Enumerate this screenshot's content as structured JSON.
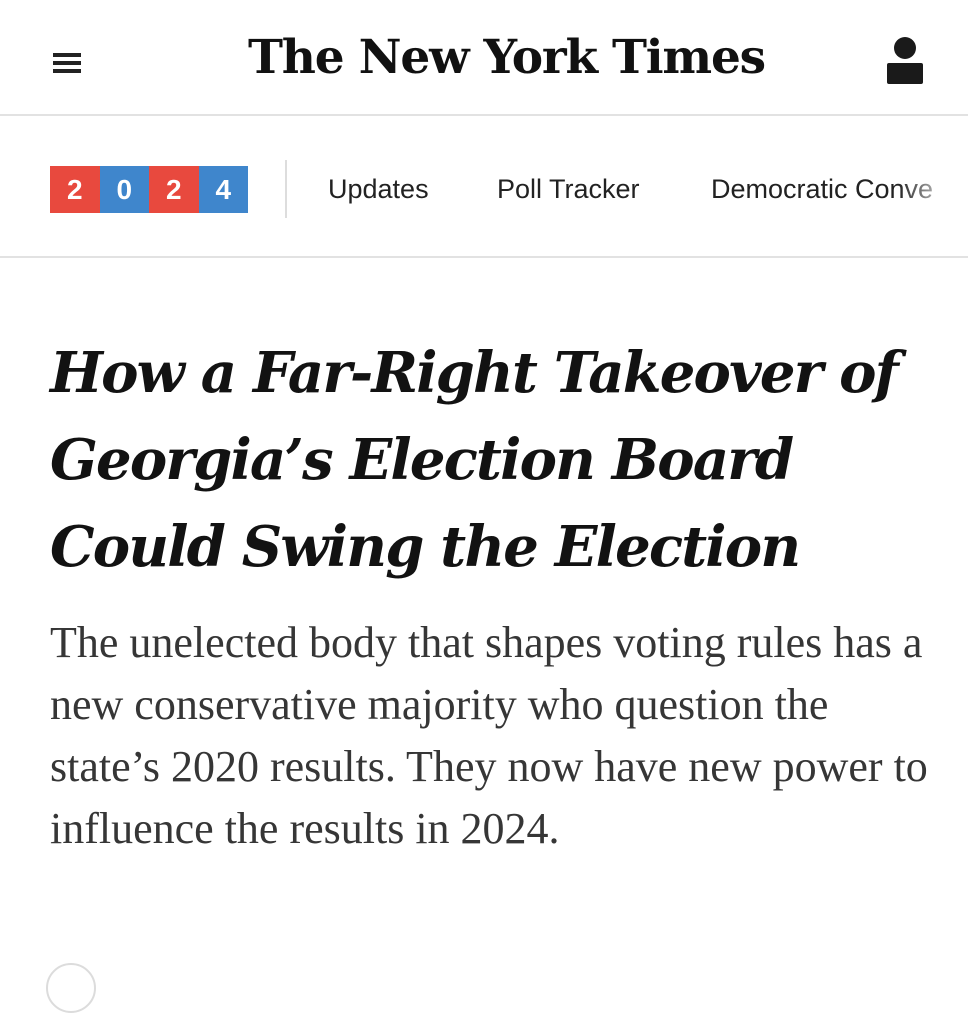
{
  "header": {
    "menu_icon": "hamburger-menu-icon",
    "logo_text": "The New York Times",
    "account_icon": "person-icon"
  },
  "nav": {
    "year_digits": [
      "2",
      "0",
      "2",
      "4"
    ],
    "year_colors": [
      "#e8493e",
      "#3f86cc",
      "#e8493e",
      "#3f86cc"
    ],
    "links": [
      "Updates",
      "Poll Tracker",
      "Democratic Conve"
    ]
  },
  "article": {
    "headline": "How a Far-Right Takeover of Georgia’s Election Board Could Swing the Election",
    "summary": "The unelected body that shapes voting rules has a new conservative majority who question the state’s 2020 results. They now have new power to influence the results in 2024."
  }
}
